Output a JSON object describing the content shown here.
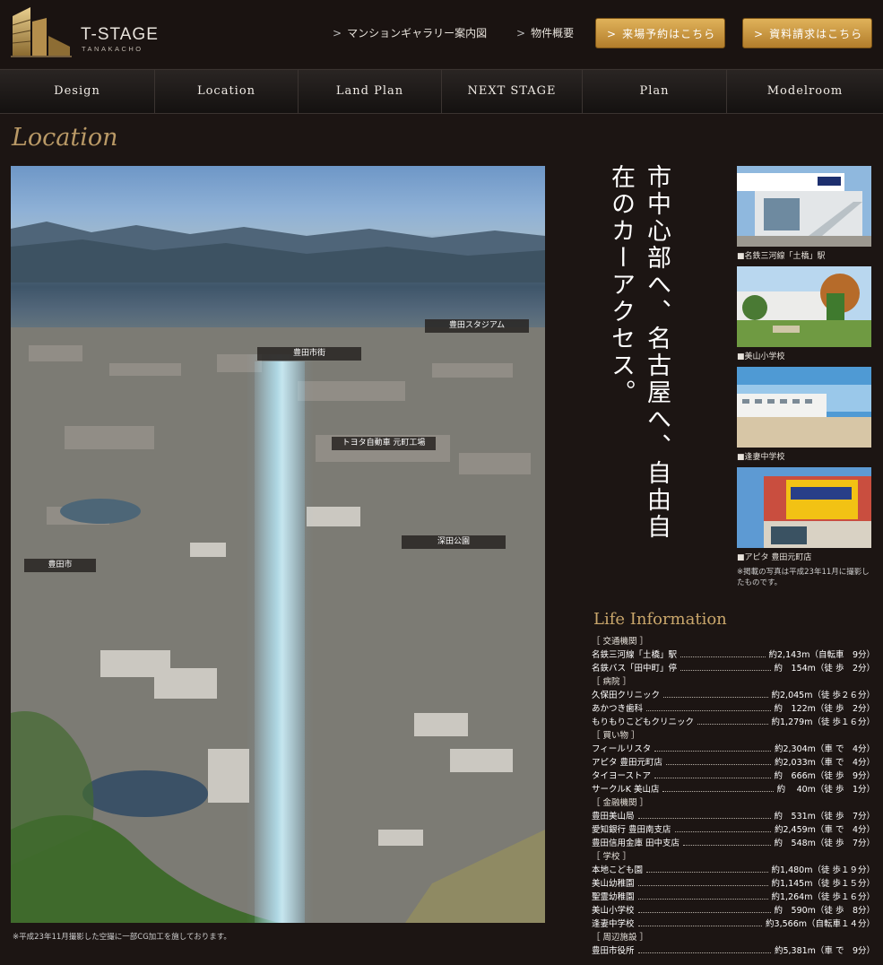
{
  "header": {
    "logo_name": "T-STAGE",
    "logo_sub": "TANAKACHO",
    "link_gallery": "マンションギャラリー案内図",
    "link_outline": "物件概要",
    "btn_reserve": "来場予約はこちら",
    "btn_request": "資料請求はこちら",
    "gold_color": "#c89440"
  },
  "nav": [
    "Design",
    "Location",
    "Land Plan",
    "NEXT STAGE",
    "Plan",
    "Modelroom"
  ],
  "section_title": "Location",
  "photo": {
    "labels": {
      "stadium": "豊田スタジアム",
      "city": "豊田市街",
      "toyota": "トヨタ自動車 元町工場",
      "park": "深田公園",
      "left": "豊田市"
    },
    "caption": "※平成23年11月撮影した空撮に一部CG加工を施しております。"
  },
  "headline": "市中心部へ、名古屋へ、自由自在のカーアクセス。",
  "thumbs": [
    {
      "caption": "■名鉄三河線「土橋」駅"
    },
    {
      "caption": "■美山小学校"
    },
    {
      "caption": "■逢妻中学校"
    },
    {
      "caption": "■アピタ 豊田元町店"
    }
  ],
  "thumb_note": "※掲載の写真は平成23年11月に撮影したものです。",
  "life": {
    "title": "Life Information",
    "rows": [
      {
        "cat": "［ 交通機関 ］"
      },
      {
        "name": "名鉄三河線「土橋」駅",
        "dist": "約2,143m（自転車　9分）"
      },
      {
        "name": "名鉄バス「田中町」停",
        "dist": "約　154m（徒 歩　2分）"
      },
      {
        "cat": "［ 病院 ］"
      },
      {
        "name": "久保田クリニック",
        "dist": "約2,045m（徒 歩２６分）"
      },
      {
        "name": "あかつき歯科",
        "dist": "約　122m（徒 歩　2分）"
      },
      {
        "name": "もりもりこどもクリニック",
        "dist": "約1,279m（徒 歩１６分）"
      },
      {
        "cat": "［ 買い物 ］"
      },
      {
        "name": "フィールリスタ",
        "dist": "約2,304m（車 で　4分）"
      },
      {
        "name": "アピタ 豊田元町店",
        "dist": "約2,033m（車 で　4分）"
      },
      {
        "name": "タイヨーストア",
        "dist": "約　666m（徒 歩　9分）"
      },
      {
        "name": "サークルK 美山店",
        "dist": "約　 40m（徒 歩　1分）"
      },
      {
        "cat": "［ 金融機関 ］"
      },
      {
        "name": "豊田美山局",
        "dist": "約　531m（徒 歩　7分）"
      },
      {
        "name": "愛知銀行 豊田南支店",
        "dist": "約2,459m（車 で　4分）"
      },
      {
        "name": "豊田信用金庫 田中支店",
        "dist": "約　548m（徒 歩　7分）"
      },
      {
        "cat": "［ 学校 ］"
      },
      {
        "name": "本地こども園",
        "dist": "約1,480m（徒 歩１９分）"
      },
      {
        "name": "美山幼稚園",
        "dist": "約1,145m（徒 歩１５分）"
      },
      {
        "name": "聖霊幼稚園",
        "dist": "約1,264m（徒 歩１６分）"
      },
      {
        "name": "美山小学校",
        "dist": "約　590m（徒 歩　8分）"
      },
      {
        "name": "逢妻中学校",
        "dist": "約3,566m（自転車１４分）"
      },
      {
        "cat": "［ 周辺施設 ］"
      },
      {
        "name": "豊田市役所",
        "dist": "約5,381m（車 で　9分）"
      }
    ]
  }
}
